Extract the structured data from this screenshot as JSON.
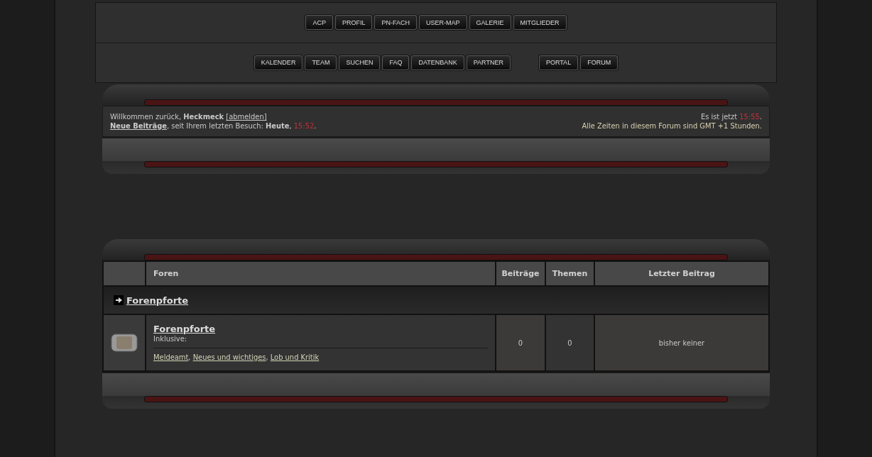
{
  "nav": {
    "rows": [
      [
        [
          "ACP",
          "PROFIL",
          "PN-FACH",
          "USER-MAP",
          "GALERIE",
          "MITGLIEDER"
        ]
      ],
      [
        [
          "KALENDER",
          "TEAM",
          "SUCHEN",
          "FAQ",
          "DATENBANK",
          "PARTNER"
        ],
        [
          "PORTAL",
          "FORUM"
        ]
      ]
    ]
  },
  "welcome": {
    "line1": {
      "text": "Willkommen zurück, **Heckmeck** ",
      "link": "[abmelden]"
    },
    "line2": {
      "link": "Neue Beiträge",
      "text": ", seit Ihrem letzten Besuch: **Heute**, ",
      "time": "15:52",
      "end": "."
    },
    "now": {
      "text": "Es ist jetzt ",
      "time": "15:55",
      "end": "."
    },
    "timezone": "Alle Zeiten in diesem Forum sind GMT +1 Stunden."
  },
  "table": {
    "columns": [
      "Foren",
      "Beiträge",
      "Themen",
      "Letzter Beitrag"
    ],
    "category": "Forenpforte",
    "rows": [
      {
        "title": "Forenpforte",
        "desc": "Inklusive:",
        "subforums": [
          "Meldeamt",
          "Neues und wichtiges",
          "Lob und Kritik"
        ],
        "separator": ", ",
        "posts": "0",
        "topics": "0",
        "last": "bisher keiner"
      }
    ]
  }
}
